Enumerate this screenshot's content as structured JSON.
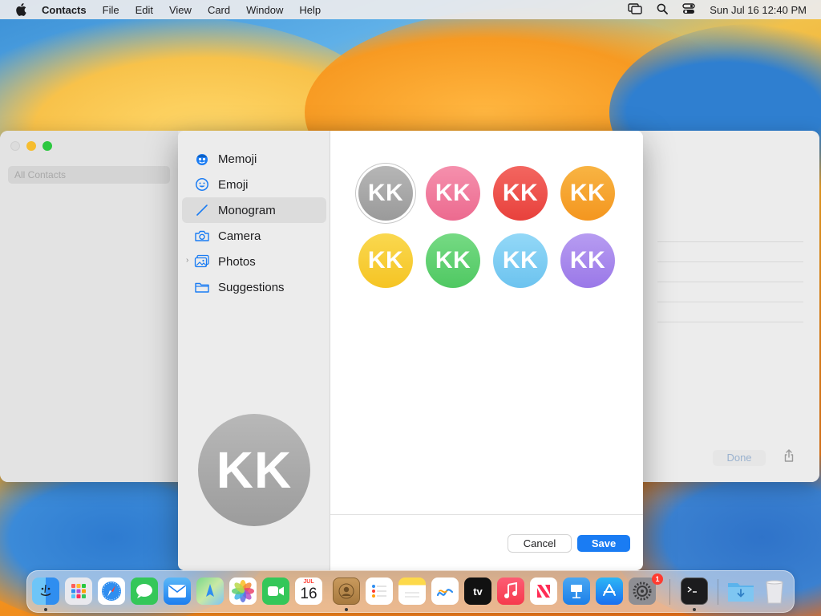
{
  "menubar": {
    "app_name": "Contacts",
    "menus": [
      "File",
      "Edit",
      "View",
      "Card",
      "Window",
      "Help"
    ],
    "clock": "Sun Jul 16  12:40 PM"
  },
  "background_window": {
    "sidebar_item": "All Contacts",
    "done_label": "Done"
  },
  "sheet": {
    "sources": [
      {
        "label": "Memoji",
        "icon": "memoji-icon"
      },
      {
        "label": "Emoji",
        "icon": "emoji-icon"
      },
      {
        "label": "Monogram",
        "icon": "pencil-icon",
        "selected": true
      },
      {
        "label": "Camera",
        "icon": "camera-icon"
      },
      {
        "label": "Photos",
        "icon": "photos-icon",
        "expandable": true
      },
      {
        "label": "Suggestions",
        "icon": "folder-icon"
      }
    ],
    "preview_initials": "KK",
    "monograms": [
      {
        "initials": "KK",
        "color": "#a8a8a8",
        "selected": true
      },
      {
        "initials": "KK",
        "color": "#f07a9c"
      },
      {
        "initials": "KK",
        "color": "#ef4d48"
      },
      {
        "initials": "KK",
        "color": "#f6a02b"
      },
      {
        "initials": "KK",
        "color": "#f7cd36"
      },
      {
        "initials": "KK",
        "color": "#5fd170"
      },
      {
        "initials": "KK",
        "color": "#7fcdf3"
      },
      {
        "initials": "KK",
        "color": "#a98aed"
      }
    ],
    "cancel_label": "Cancel",
    "save_label": "Save"
  },
  "dock": {
    "calendar_month": "JUL",
    "calendar_day": "16",
    "tv_label": "tv",
    "settings_badge": "1",
    "apps": [
      "Finder",
      "Launchpad",
      "Safari",
      "Messages",
      "Mail",
      "Maps",
      "Photos",
      "FaceTime",
      "Calendar",
      "Contacts",
      "Reminders",
      "Notes",
      "Freeform",
      "TV",
      "Music",
      "News",
      "Keynote",
      "App Store",
      "System Settings",
      "Terminal",
      "Downloads",
      "Trash"
    ]
  },
  "colors": {
    "accent": "#1a7cf3",
    "sidebar_selected": "#dcdcdc"
  }
}
